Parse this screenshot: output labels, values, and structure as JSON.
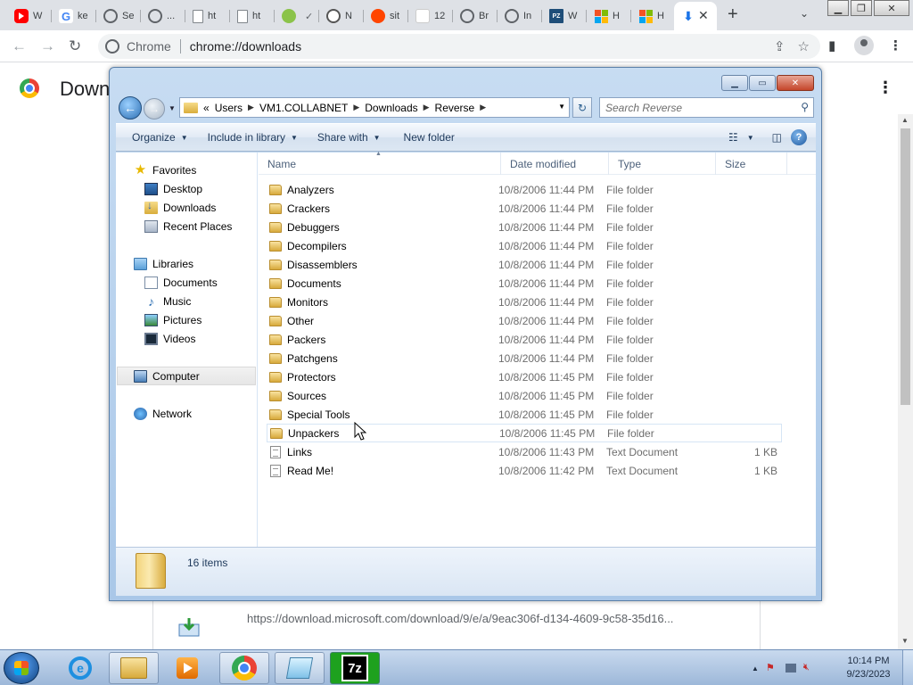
{
  "browser": {
    "tabs": [
      {
        "label": "W",
        "icon": "youtube-icon"
      },
      {
        "label": "ke",
        "icon": "google-icon"
      },
      {
        "label": "Se",
        "icon": "globe-icon"
      },
      {
        "label": "...",
        "icon": "globe-icon"
      },
      {
        "label": "ht",
        "icon": "page-icon"
      },
      {
        "label": "ht",
        "icon": "page-icon"
      },
      {
        "label": "",
        "icon": "green-site-icon"
      },
      {
        "label": "N",
        "icon": "globe-icon"
      },
      {
        "label": "sit",
        "icon": "reddit-icon"
      },
      {
        "label": "12",
        "icon": "page-icon"
      },
      {
        "label": "Br",
        "icon": "globe-icon"
      },
      {
        "label": "In",
        "icon": "globe-icon"
      },
      {
        "label": "W",
        "icon": "pz-icon"
      },
      {
        "label": "H",
        "icon": "microsoft-icon"
      },
      {
        "label": "H",
        "icon": "microsoft-icon"
      },
      {
        "label": "",
        "icon": "download-icon",
        "active": true
      }
    ],
    "omnibox": {
      "chip": "Chrome",
      "url": "chrome://downloads"
    },
    "page": {
      "title": "Down",
      "download_url": "https://download.microsoft.com/download/9/e/a/9eac306f-d134-4609-9c58-35d16..."
    }
  },
  "explorer": {
    "breadcrumb": {
      "overflow": "«",
      "parts": [
        "Users",
        "VM1.COLLABNET",
        "Downloads",
        "Reverse"
      ]
    },
    "search_placeholder": "Search Reverse",
    "commands": {
      "organize": "Organize",
      "include": "Include in library",
      "share": "Share with",
      "new_folder": "New folder"
    },
    "nav": {
      "favorites": "Favorites",
      "favorites_items": [
        "Desktop",
        "Downloads",
        "Recent Places"
      ],
      "libraries": "Libraries",
      "library_items": [
        "Documents",
        "Music",
        "Pictures",
        "Videos"
      ],
      "computer": "Computer",
      "network": "Network"
    },
    "columns": {
      "name": "Name",
      "date": "Date modified",
      "type": "Type",
      "size": "Size"
    },
    "files": [
      {
        "name": "Analyzers",
        "date": "10/8/2006 11:44 PM",
        "type": "File folder",
        "size": "",
        "kind": "folder"
      },
      {
        "name": "Crackers",
        "date": "10/8/2006 11:44 PM",
        "type": "File folder",
        "size": "",
        "kind": "folder"
      },
      {
        "name": "Debuggers",
        "date": "10/8/2006 11:44 PM",
        "type": "File folder",
        "size": "",
        "kind": "folder"
      },
      {
        "name": "Decompilers",
        "date": "10/8/2006 11:44 PM",
        "type": "File folder",
        "size": "",
        "kind": "folder"
      },
      {
        "name": "Disassemblers",
        "date": "10/8/2006 11:44 PM",
        "type": "File folder",
        "size": "",
        "kind": "folder"
      },
      {
        "name": "Documents",
        "date": "10/8/2006 11:44 PM",
        "type": "File folder",
        "size": "",
        "kind": "folder"
      },
      {
        "name": "Monitors",
        "date": "10/8/2006 11:44 PM",
        "type": "File folder",
        "size": "",
        "kind": "folder"
      },
      {
        "name": "Other",
        "date": "10/8/2006 11:44 PM",
        "type": "File folder",
        "size": "",
        "kind": "folder"
      },
      {
        "name": "Packers",
        "date": "10/8/2006 11:44 PM",
        "type": "File folder",
        "size": "",
        "kind": "folder"
      },
      {
        "name": "Patchgens",
        "date": "10/8/2006 11:44 PM",
        "type": "File folder",
        "size": "",
        "kind": "folder"
      },
      {
        "name": "Protectors",
        "date": "10/8/2006 11:45 PM",
        "type": "File folder",
        "size": "",
        "kind": "folder"
      },
      {
        "name": "Sources",
        "date": "10/8/2006 11:45 PM",
        "type": "File folder",
        "size": "",
        "kind": "folder"
      },
      {
        "name": "Special Tools",
        "date": "10/8/2006 11:45 PM",
        "type": "File folder",
        "size": "",
        "kind": "folder"
      },
      {
        "name": "Unpackers",
        "date": "10/8/2006 11:45 PM",
        "type": "File folder",
        "size": "",
        "kind": "folder"
      },
      {
        "name": "Links",
        "date": "10/8/2006 11:43 PM",
        "type": "Text Document",
        "size": "1 KB",
        "kind": "text"
      },
      {
        "name": "Read Me!",
        "date": "10/8/2006 11:42 PM",
        "type": "Text Document",
        "size": "1 KB",
        "kind": "text"
      }
    ],
    "status": {
      "count": "16 items"
    }
  },
  "taskbar": {
    "time": "10:14 PM",
    "date": "9/23/2023"
  }
}
